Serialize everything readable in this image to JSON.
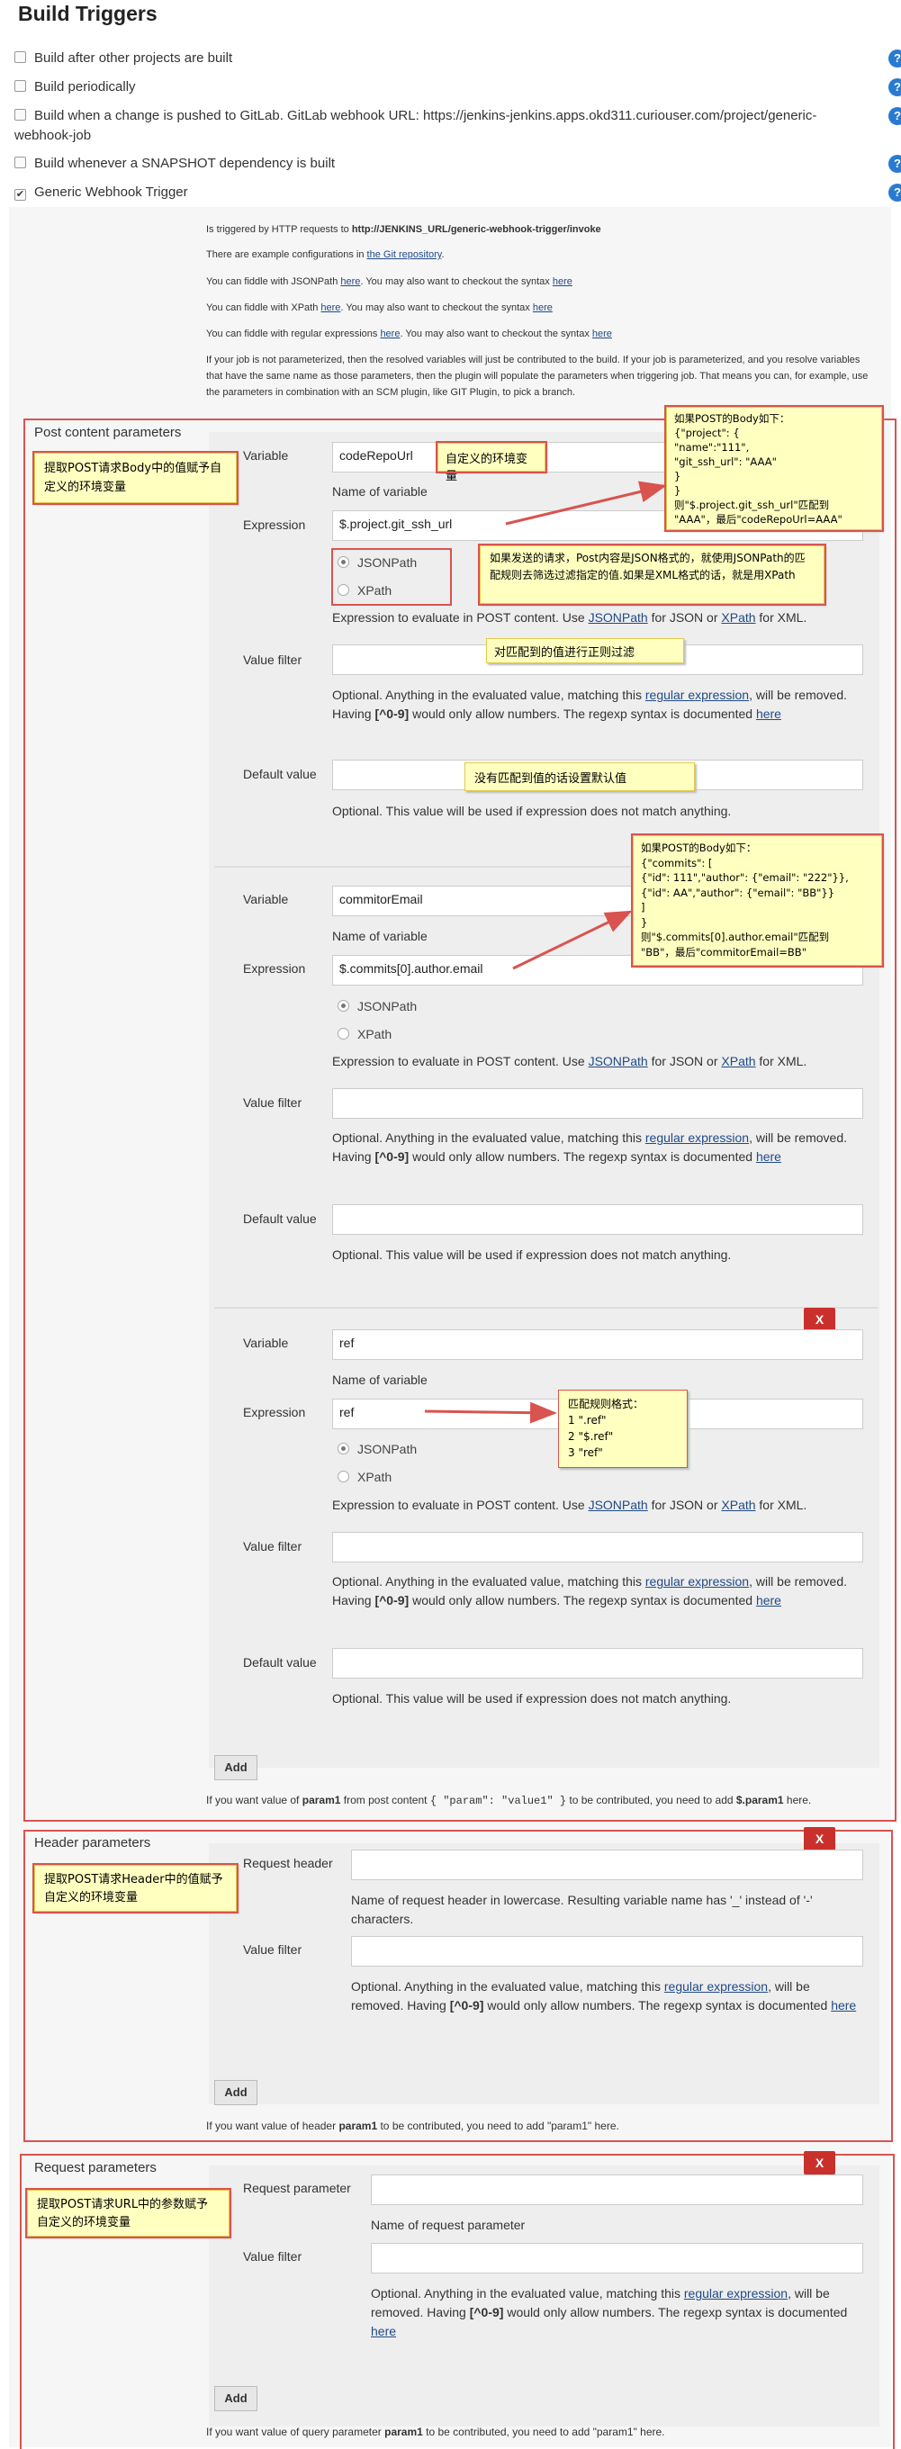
{
  "title": "Build Triggers",
  "triggers": [
    {
      "label": "Build after other projects are built",
      "checked": false
    },
    {
      "label": "Build periodically",
      "checked": false
    },
    {
      "label": "Build when a change is pushed to GitLab. GitLab webhook URL: https://jenkins-jenkins.apps.okd311.curiouser.com/project/generic-webhook-job",
      "checked": false
    },
    {
      "label": "Build whenever a SNAPSHOT dependency is built",
      "checked": false
    },
    {
      "label": "Generic Webhook Trigger",
      "checked": true
    }
  ],
  "help_icon": "?",
  "info": {
    "line1_a": "Is triggered by HTTP requests to ",
    "line1_b": "http://JENKINS_URL/generic-webhook-trigger/invoke",
    "line2_a": "There are example configurations in ",
    "line2_link": "the Git repository",
    "line2_b": ".",
    "line3_a": "You can fiddle with JSONPath ",
    "line3_link1": "here",
    "line3_b": ". You may also want to checkout the syntax ",
    "line3_link2": "here",
    "line4_a": "You can fiddle with XPath ",
    "line4_link1": "here",
    "line4_b": ". You may also want to checkout the syntax ",
    "line4_link2": "here",
    "line5_a": "You can fiddle with regular expressions ",
    "line5_link1": "here",
    "line5_b": ". You may also want to checkout the syntax ",
    "line5_link2": "here",
    "para": "If your job is not parameterized, then the resolved variables will just be contributed to the build. If your job is parameterized, and you resolve variables that have the same name as those parameters, then the plugin will populate the parameters when triggering job. That means you can, for example, use the parameters in combination with an SCM plugin, like GIT Plugin, to pick a branch."
  },
  "labels": {
    "variable": "Variable",
    "expression": "Expression",
    "value_filter": "Value filter",
    "default_value": "Default value",
    "name_of_variable": "Name of variable",
    "jsonpath": "JSONPath",
    "xpath": "XPath",
    "expr_hint_a": "Expression to evaluate in POST content. Use ",
    "expr_hint_link1": "JSONPath",
    "expr_hint_b": " for JSON or ",
    "expr_hint_link2": "XPath",
    "expr_hint_c": " for XML.",
    "filter_hint_a": "Optional. Anything in the evaluated value, matching this ",
    "filter_hint_link": "regular expression",
    "filter_hint_b": ", will be removed. Having ",
    "filter_hint_bold": "[^0-9]",
    "filter_hint_c": " would only allow numbers. The regexp syntax is documented ",
    "filter_hint_here": "here",
    "default_hint": "Optional. This value will be used if expression does not match anything.",
    "delete": "X",
    "add": "Add",
    "request_header": "Request header",
    "header_hint": "Name of request header in lowercase. Resulting variable name has '_' instead of '-' characters.",
    "request_parameter": "Request parameter",
    "param_hint": "Name of request parameter"
  },
  "post_section": {
    "title": "Post content parameters",
    "entries": [
      {
        "variable": "codeRepoUrl",
        "expression": "$.project.git_ssh_url",
        "json_selected": true
      },
      {
        "variable": "commitorEmail",
        "expression": "$.commits[0].author.email",
        "json_selected": true
      },
      {
        "variable": "ref",
        "expression": "ref",
        "json_selected": true
      }
    ],
    "footer_a": "If you want value of ",
    "footer_b": "param1",
    "footer_c": " from post content ",
    "footer_code": "{ \"param\": \"value1\" }",
    "footer_d": " to be contributed, you need to add ",
    "footer_e": "$.param1",
    "footer_f": " here."
  },
  "header_section": {
    "title": "Header parameters",
    "footer_a": "If you want value of header ",
    "footer_b": "param1",
    "footer_c": " to be contributed, you need to add \"param1\" here."
  },
  "request_section": {
    "title": "Request parameters",
    "footer_a": "If you want value of query parameter ",
    "footer_b": "param1",
    "footer_c": " to be contributed, you need to add \"param1\" here."
  },
  "annotations": {
    "post_body": "提取POST请求Body中的值赋予自定义的环境变量",
    "custom_env": "自定义的环境变量",
    "body_example_1": [
      "如果POST的Body如下：",
      "{\"project\": {",
      "      \"name\":\"111\",",
      "      \"git_ssh_url\": \"AAA\"",
      "   }",
      "}",
      "则\"$.project.git_ssh_url\"匹配到",
      "\"AAA\"，最后\"codeRepoUrl=AAA\""
    ],
    "json_xpath": "如果发送的请求，Post内容是JSON格式的，就使用JSONPath的匹配规则去筛选过滤指定的值.如果是XML格式的话，就是用XPath",
    "regex_filter": "对匹配到的值进行正则过滤",
    "default_note": "没有匹配到值的话设置默认值",
    "body_example_2": [
      "如果POST的Body如下：",
      "{\"commits\": [",
      "     {\"id\": 111\",\"author\": {\"email\": \"222\"}},",
      "     {\"id\": AA\",\"author\": {\"email\": \"BB\"}}",
      "   ]",
      "}",
      "则\"$.commits[0].author.email\"匹配到",
      "\"BB\"，最后\"commitorEmail=BB\""
    ],
    "match_rules": [
      "匹配规则格式：",
      "1 \".ref\"",
      "2 \"$.ref\"",
      "3 \"ref\""
    ],
    "header_note": "提取POST请求Header中的值赋予自定义的环境变量",
    "request_note": "提取POST请求URL中的参数赋予自定义的环境变量"
  },
  "colors": {
    "annotation_red": "#d9534f",
    "delete_button": "#c9302c",
    "help_icon": "#2a7bd0",
    "note_bg": "#ffffc0"
  }
}
